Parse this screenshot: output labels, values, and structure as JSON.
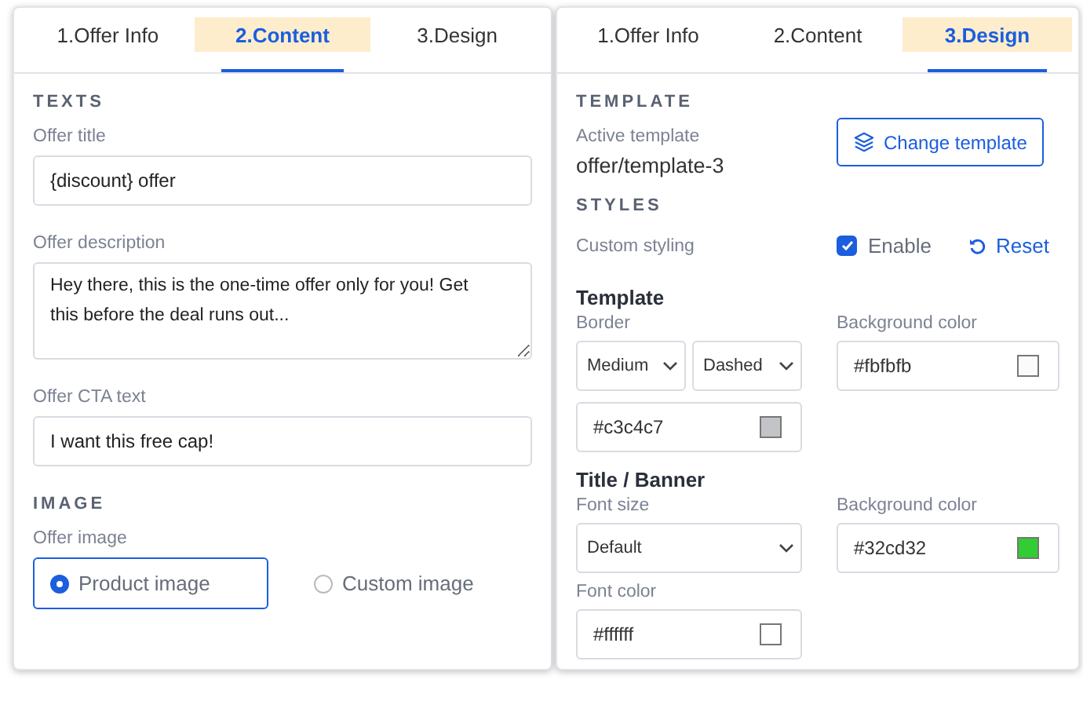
{
  "panels": [
    {
      "tabs": [
        {
          "label": "1.Offer Info",
          "selected": false
        },
        {
          "label": "2.Content",
          "selected": true
        },
        {
          "label": "3.Design",
          "selected": false
        }
      ],
      "sections": [
        {
          "kind": "heading",
          "text": "TEXTS"
        },
        {
          "kind": "text-field",
          "label": "Offer title",
          "value": "{discount} offer"
        },
        {
          "kind": "textarea",
          "label": "Offer description",
          "value": "Hey there, this is the one-time offer only for you! Get this before the deal runs out..."
        },
        {
          "kind": "text-field",
          "label": "Offer CTA text",
          "value": "I want this free cap!"
        },
        {
          "kind": "heading",
          "text": "IMAGE"
        },
        {
          "kind": "radio-group",
          "label": "Offer image",
          "options": [
            {
              "label": "Product image",
              "selected": true
            },
            {
              "label": "Custom image",
              "selected": false
            }
          ]
        }
      ]
    },
    {
      "tabs": [
        {
          "label": "1.Offer Info",
          "selected": false
        },
        {
          "label": "2.Content",
          "selected": false
        },
        {
          "label": "3.Design",
          "selected": true
        }
      ],
      "sections": [
        {
          "kind": "heading",
          "text": "TEMPLATE"
        },
        {
          "kind": "template-row",
          "label": "Active template",
          "value": "offer/template-3",
          "button": "Change template"
        },
        {
          "kind": "heading",
          "text": "STYLES"
        },
        {
          "kind": "toggle-row",
          "label": "Custom styling",
          "checkbox": {
            "label": "Enable",
            "checked": true
          },
          "reset": "Reset"
        },
        {
          "kind": "style-group",
          "title": "Template",
          "columns": [
            [
              {
                "label": "Border",
                "controls": [
                  {
                    "kind": "select",
                    "value": "Medium"
                  },
                  {
                    "kind": "select",
                    "value": "Dashed"
                  },
                  {
                    "kind": "color",
                    "value": "#c3c4c7",
                    "color": "#c3c4c7"
                  }
                ]
              }
            ],
            [
              {
                "label": "Background color",
                "controls": [
                  {
                    "kind": "color",
                    "value": "#fbfbfb",
                    "color": "#fbfbfb"
                  }
                ]
              }
            ]
          ]
        },
        {
          "kind": "style-group",
          "title": "Title / Banner",
          "columns": [
            [
              {
                "label": "Font size",
                "controls": [
                  {
                    "kind": "select",
                    "value": "Default"
                  }
                ]
              },
              {
                "label": "Font color",
                "controls": [
                  {
                    "kind": "color",
                    "value": "#ffffff",
                    "color": "#ffffff"
                  }
                ]
              }
            ],
            [
              {
                "label": "Background color",
                "controls": [
                  {
                    "kind": "color",
                    "value": "#32cd32",
                    "color": "#32cd32"
                  }
                ]
              }
            ]
          ]
        }
      ]
    }
  ]
}
